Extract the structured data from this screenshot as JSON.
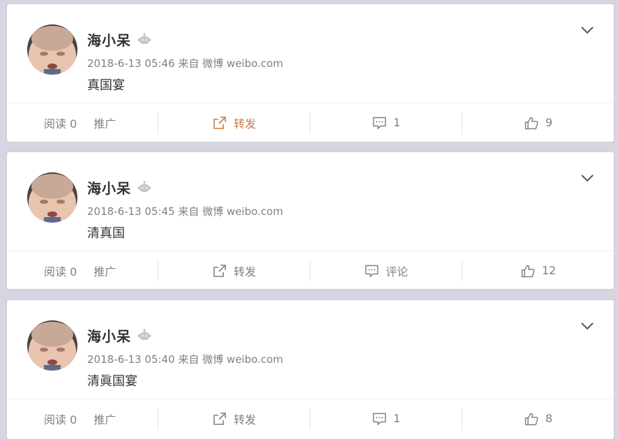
{
  "posts": [
    {
      "username": "海小呆",
      "meta": "2018-6-13 05:46 来自 微博 weibo.com",
      "content": "真国宴",
      "read": "阅读 0",
      "promote": "推广",
      "forward": "转发",
      "comment": "1",
      "like": "9",
      "forward_active": true
    },
    {
      "username": "海小呆",
      "meta": "2018-6-13 05:45 来自 微博 weibo.com",
      "content": "清真国",
      "read": "阅读 0",
      "promote": "推广",
      "forward": "转发",
      "comment": "评论",
      "like": "12",
      "forward_active": false
    },
    {
      "username": "海小呆",
      "meta": "2018-6-13 05:40 来自 微博 weibo.com",
      "content": "清眞国宴",
      "read": "阅读 0",
      "promote": "推广",
      "forward": "转发",
      "comment": "1",
      "like": "8",
      "forward_active": false
    }
  ],
  "colors": {
    "page_bg": "#d6d5e1",
    "card_bg": "#ffffff",
    "accent_forward": "#c9794e",
    "text_meta": "#808080"
  },
  "icons": [
    "robot-icon",
    "chevron-down-icon",
    "share-icon",
    "comment-icon",
    "thumbs-up-icon"
  ]
}
